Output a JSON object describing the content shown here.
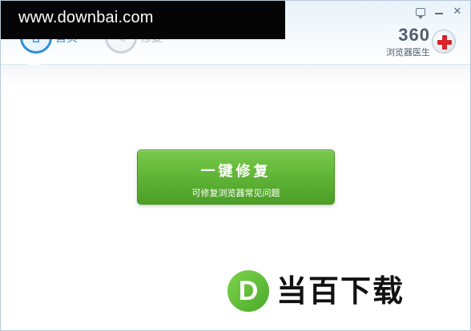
{
  "watermark": {
    "text": "www.downbai.com"
  },
  "tabs": [
    {
      "label": "首页"
    },
    {
      "label": "修复"
    }
  ],
  "brand": {
    "number": "360",
    "name": "浏览器医生"
  },
  "main_button": {
    "title": "一键修复",
    "subtitle": "可修复浏览器常见问题"
  },
  "site_logo": {
    "letter": "D",
    "text": "当百下载"
  },
  "colors": {
    "accent": "#2e8fd6",
    "button_green": "#5fb436",
    "logo_red": "#d8232a",
    "watermark_bg": "#050505"
  }
}
